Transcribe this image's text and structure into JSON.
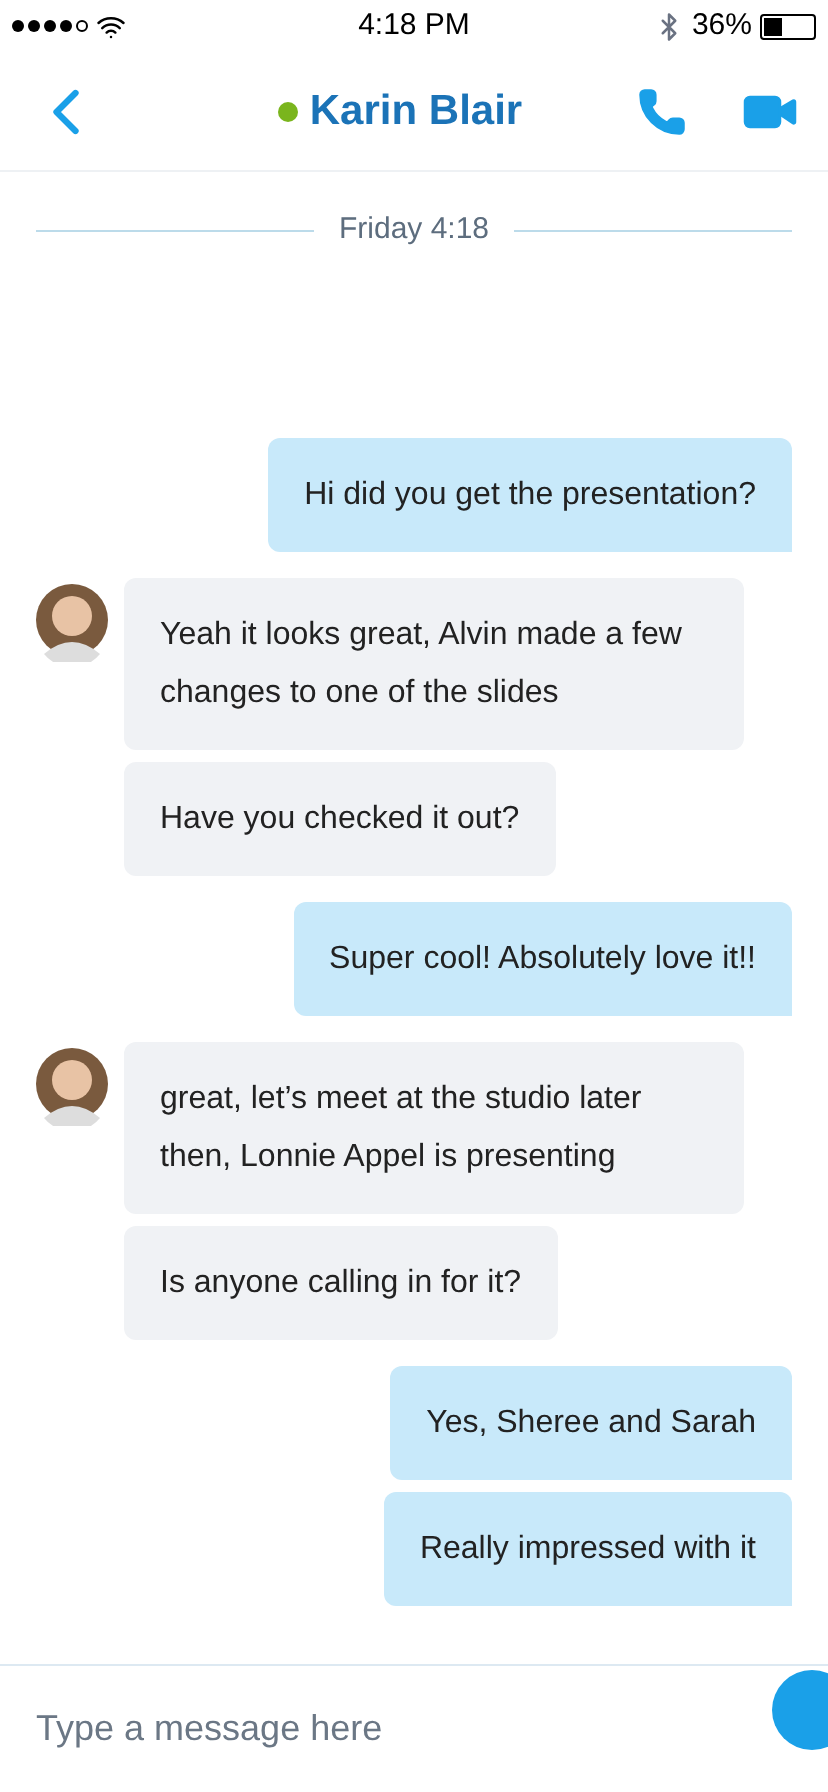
{
  "status_bar": {
    "time": "4:18 PM",
    "battery": "36%"
  },
  "header": {
    "contact": "Karin Blair",
    "online": true
  },
  "date_divider": "Friday 4:18",
  "messages": [
    {
      "kind": "outgoing",
      "text": "Hi did you get the presentation?",
      "avatar": false
    },
    {
      "kind": "incoming",
      "text": "Yeah it looks great, Alvin made a few changes to one of the slides",
      "avatar": true
    },
    {
      "kind": "incoming",
      "text": "Have you checked it out?",
      "avatar": false
    },
    {
      "kind": "outgoing",
      "text": "Super cool! Absolutely love it!!",
      "avatar": false
    },
    {
      "kind": "incoming",
      "text": "great, let’s meet at the studio later then, Lonnie Appel is presenting",
      "avatar": true
    },
    {
      "kind": "incoming",
      "text": "Is anyone calling in for it?",
      "avatar": false
    },
    {
      "kind": "outgoing",
      "text": "Yes, Sheree and Sarah",
      "avatar": false
    },
    {
      "kind": "outgoing",
      "text": "Really impressed with it",
      "avatar": false
    }
  ],
  "composer": {
    "placeholder": "Type a message here"
  }
}
